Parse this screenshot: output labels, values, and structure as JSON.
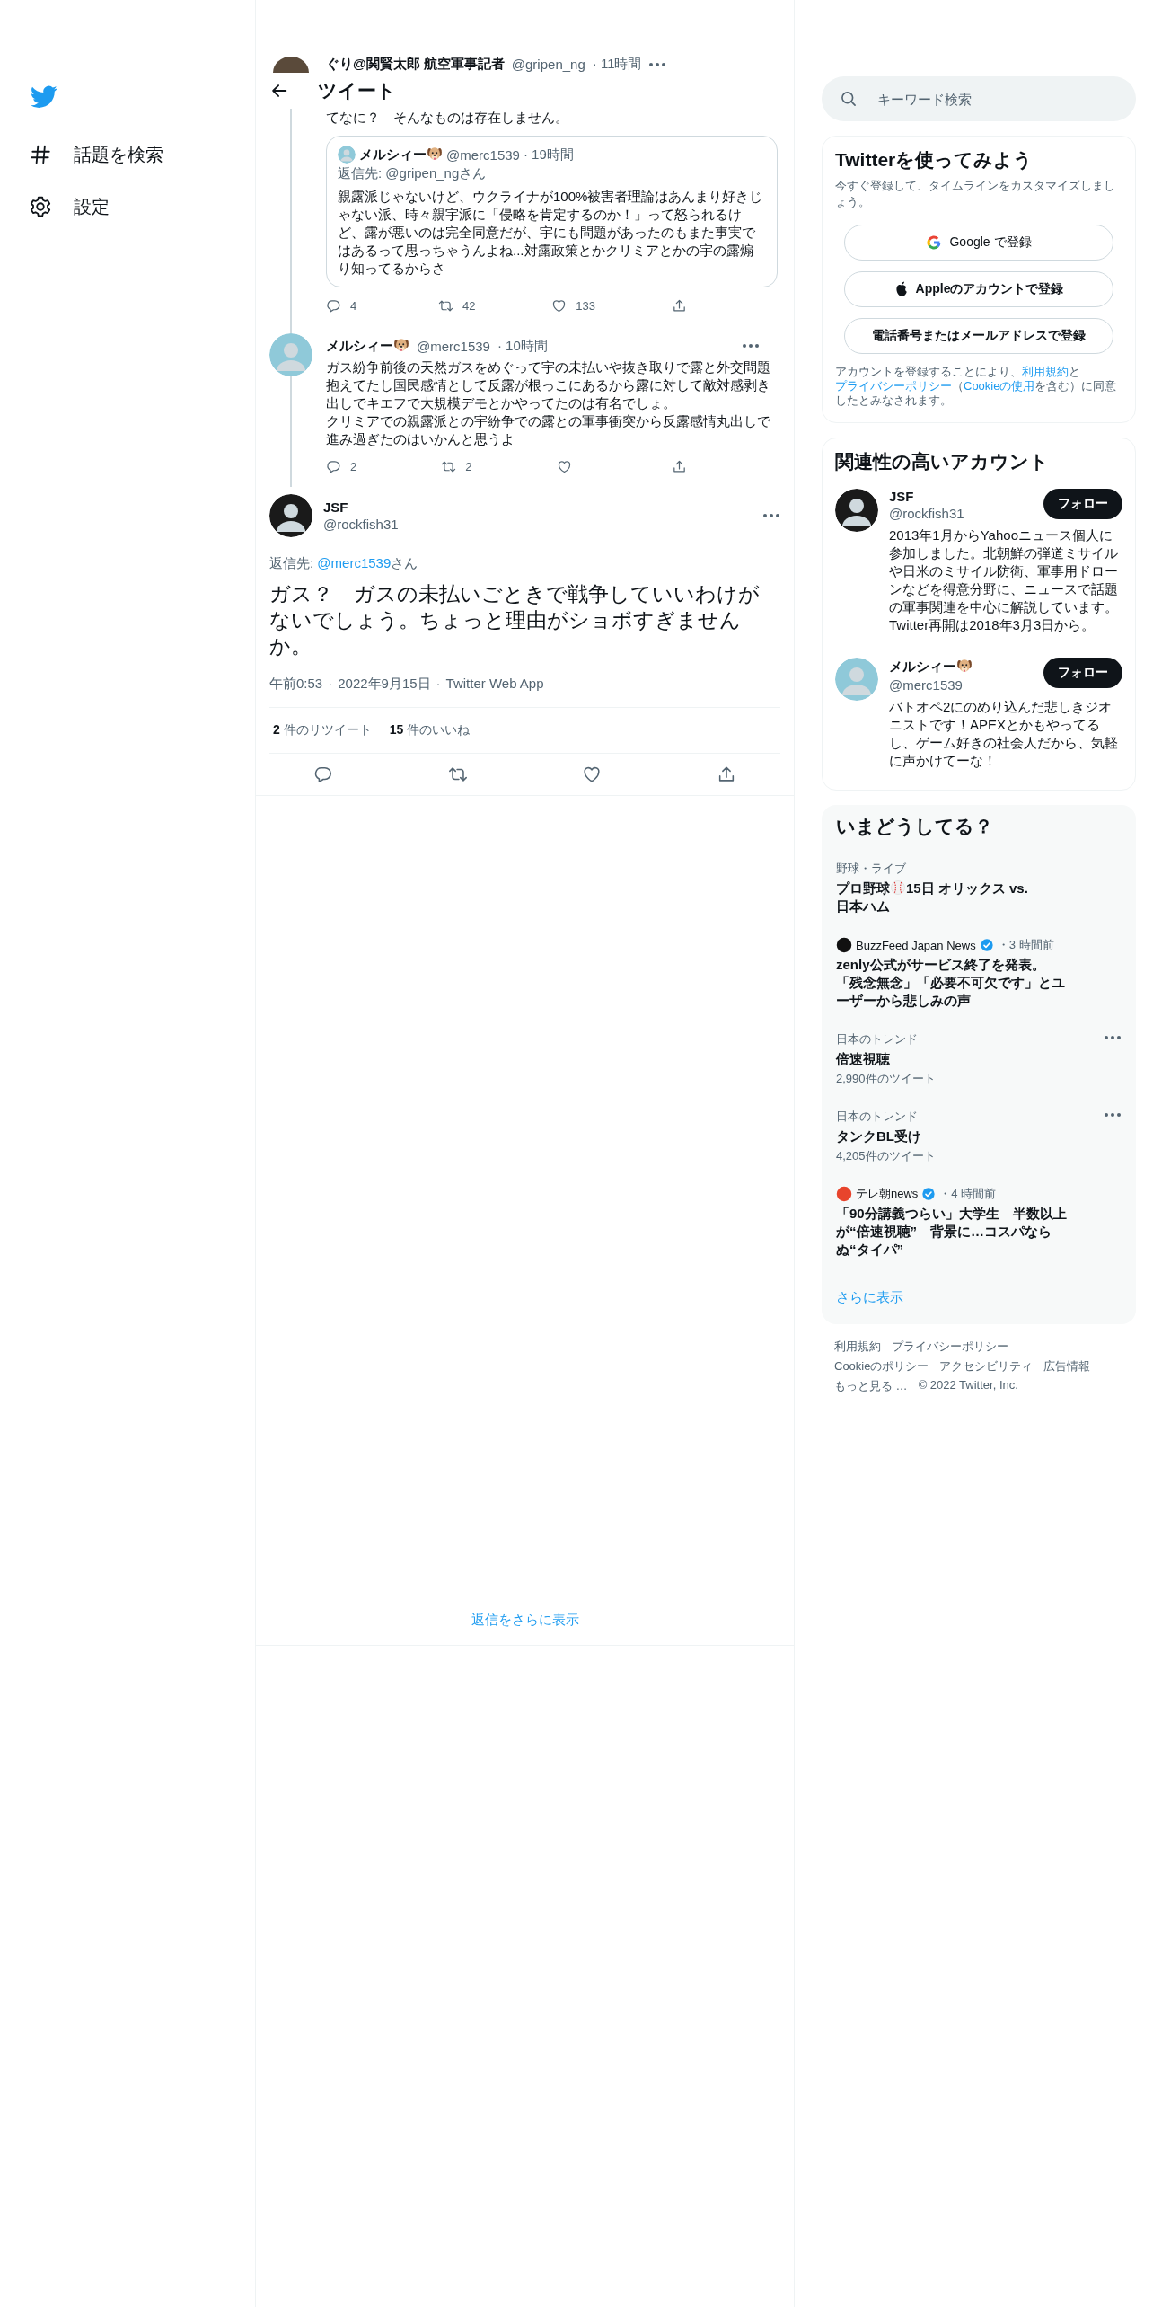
{
  "sidebar": {
    "items": [
      {
        "kind": "hash",
        "label": "話題を検索"
      },
      {
        "kind": "gear",
        "label": "設定"
      }
    ]
  },
  "header": {
    "title": "ツイート"
  },
  "thread": [
    {
      "name": "ぐり@関賢太郎 航空軍事記者",
      "name_emoji": false,
      "handle": "@gripen_ng",
      "time": "· 11時間",
      "text": "てなに？　そんなものは存在しません。",
      "quote": {
        "name": "メルシィー",
        "name_emoji": true,
        "handle": "@merc1539",
        "time": "· 19時間",
        "reply_label": "返信先:",
        "reply_to": "@gripen_ngさん",
        "text": "親露派じゃないけど、ウクライナが100%被害者理論はあんまり好きじゃない派、時々親宇派に「侵略を肯定するのか！」って怒られるけど、露が悪いのは完全同意だが、宇にも問題があったのもまた事実ではあるって思っちゃうんよね...対露政策とかクリミアとかの宇の露煽り知ってるからさ"
      },
      "replies": "4",
      "retweets": "42",
      "likes": "133"
    },
    {
      "name": "メルシィー",
      "name_emoji": true,
      "handle": "@merc1539",
      "time": "· 10時間",
      "paragraphs": [
        "ガス紛争前後の天然ガスをめぐって宇の未払いや抜き取りで露と外交問題抱えてたし国民感情として反露が根っこにあるから露に対して敵対感剥き出しでキエフで大規模デモとかやってたのは有名でしょ。",
        "クリミアでの親露派との宇紛争での露との軍事衝突から反露感情丸出しで進み過ぎたのはいかんと思うよ"
      ],
      "replies": "2",
      "retweets": "2"
    }
  ],
  "main_tweet": {
    "name": "JSF",
    "handle": "@rockfish31",
    "reply_label": "返信先:",
    "reply_to": "@merc1539",
    "reply_suffix": "さん",
    "text": "ガス？　ガスの未払いごときで戦争していいわけがないでしょう。ちょっと理由がショボすぎませんか。",
    "meta": [
      "午前0:53",
      "·",
      "2022年9月15日",
      "·",
      "Twitter Web App"
    ],
    "stats": [
      {
        "count": "2",
        "label": "件のリツイート"
      },
      {
        "count": "15",
        "label": "件のいいね"
      }
    ]
  },
  "more_replies": "返信をさらに表示",
  "search": {
    "placeholder": "キーワード検索"
  },
  "signup": {
    "title": "Twitterを使ってみよう",
    "subtitle": "今すぐ登録して、タイムラインをカスタマイズしましょう。",
    "buttons": [
      {
        "kind": "google",
        "label": "Google で登録"
      },
      {
        "kind": "apple",
        "label": "Appleのアカウントで登録"
      },
      {
        "kind": "plain",
        "label": "電話番号またはメールアドレスで登録"
      }
    ],
    "legal": [
      {
        "text": "アカウントを登録することにより、",
        "link": false
      },
      {
        "text": "利用規約",
        "link": true
      },
      {
        "text": "と",
        "link": false
      },
      {
        "text": "プライバシーポリシー",
        "link": true
      },
      {
        "text": "（",
        "link": false
      },
      {
        "text": "Cookieの使用",
        "link": true
      },
      {
        "text": "を含む）に同意したとみなされます。",
        "link": false
      }
    ]
  },
  "related": {
    "title": "関連性の高いアカウント",
    "accounts": [
      {
        "name": "JSF",
        "name_emoji": false,
        "handle": "@rockfish31",
        "button": "フォロー",
        "bio": "2013年1月からYahooニュース個人に参加しました。北朝鮮の弾道ミサイルや日米のミサイル防衛、軍事用ドローンなどを得意分野に、ニュースで話題の軍事関連を中心に解説しています。Twitter再開は2018年3月3日から。"
      },
      {
        "name": "メルシィー",
        "name_emoji": true,
        "handle": "@merc1539",
        "button": "フォロー",
        "bio": "バトオペ2にのめり込んだ悲しきジオニストです！APEXとかもやってるし、ゲーム好きの社会人だから、気軽に声かけてーな！"
      }
    ]
  },
  "trends": {
    "title": "いまどうしてる？",
    "items": [
      {
        "kind": "event",
        "category": "野球・ライブ",
        "title_parts": [
          "プロ野球",
          "15日 オリックス vs.",
          "日本ハム"
        ]
      },
      {
        "kind": "news",
        "source": "BuzzFeed Japan News",
        "color": "#111111",
        "verified": true,
        "time": "・3 時間前",
        "title": "zenly公式がサービス終了を発表。「残念無念」「必要不可欠です」とユーザーから悲しみの声"
      },
      {
        "kind": "trend",
        "category": "日本のトレンド",
        "title": "倍速視聴",
        "count": "2,990件のツイート"
      },
      {
        "kind": "trend",
        "category": "日本のトレンド",
        "title": "タンクBL受け",
        "count": "4,205件のツイート"
      },
      {
        "kind": "news",
        "source": "テレ朝news",
        "color": "#e8442c",
        "verified": true,
        "time": "・4 時間前",
        "title": "「90分講義つらい」大学生　半数以上が“倍速視聴”　背景に…コスパならぬ“タイパ”"
      }
    ],
    "more": "さらに表示"
  },
  "footer": {
    "lines": [
      [
        "利用規約",
        "プライバシーポリシー"
      ],
      [
        "Cookieのポリシー",
        "アクセシビリティ",
        "広告情報"
      ],
      [
        "もっと見る …",
        "© 2022 Twitter, Inc."
      ]
    ]
  }
}
